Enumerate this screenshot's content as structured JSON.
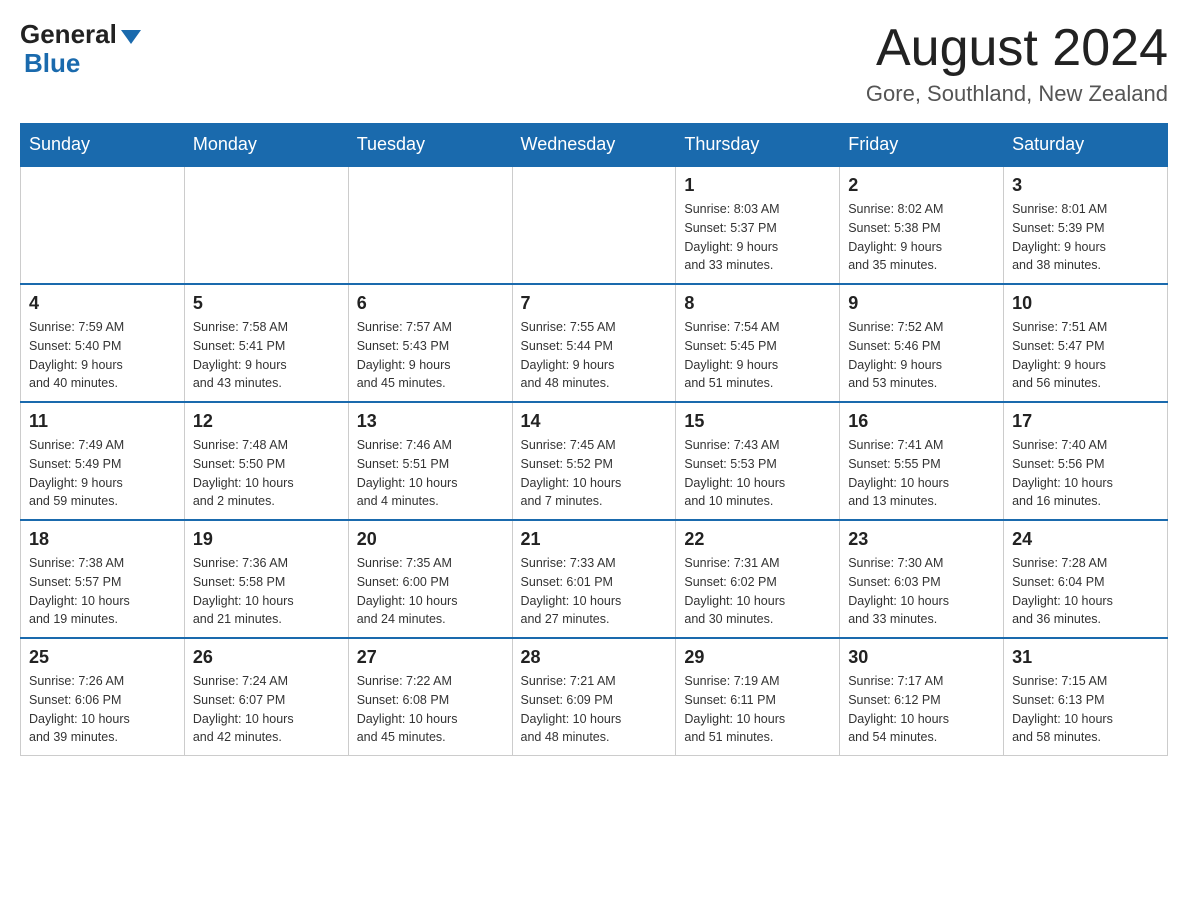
{
  "header": {
    "logo_general": "General",
    "logo_blue": "Blue",
    "month_title": "August 2024",
    "location": "Gore, Southland, New Zealand"
  },
  "days_of_week": [
    "Sunday",
    "Monday",
    "Tuesday",
    "Wednesday",
    "Thursday",
    "Friday",
    "Saturday"
  ],
  "weeks": [
    [
      {
        "day": "",
        "info": ""
      },
      {
        "day": "",
        "info": ""
      },
      {
        "day": "",
        "info": ""
      },
      {
        "day": "",
        "info": ""
      },
      {
        "day": "1",
        "info": "Sunrise: 8:03 AM\nSunset: 5:37 PM\nDaylight: 9 hours\nand 33 minutes."
      },
      {
        "day": "2",
        "info": "Sunrise: 8:02 AM\nSunset: 5:38 PM\nDaylight: 9 hours\nand 35 minutes."
      },
      {
        "day": "3",
        "info": "Sunrise: 8:01 AM\nSunset: 5:39 PM\nDaylight: 9 hours\nand 38 minutes."
      }
    ],
    [
      {
        "day": "4",
        "info": "Sunrise: 7:59 AM\nSunset: 5:40 PM\nDaylight: 9 hours\nand 40 minutes."
      },
      {
        "day": "5",
        "info": "Sunrise: 7:58 AM\nSunset: 5:41 PM\nDaylight: 9 hours\nand 43 minutes."
      },
      {
        "day": "6",
        "info": "Sunrise: 7:57 AM\nSunset: 5:43 PM\nDaylight: 9 hours\nand 45 minutes."
      },
      {
        "day": "7",
        "info": "Sunrise: 7:55 AM\nSunset: 5:44 PM\nDaylight: 9 hours\nand 48 minutes."
      },
      {
        "day": "8",
        "info": "Sunrise: 7:54 AM\nSunset: 5:45 PM\nDaylight: 9 hours\nand 51 minutes."
      },
      {
        "day": "9",
        "info": "Sunrise: 7:52 AM\nSunset: 5:46 PM\nDaylight: 9 hours\nand 53 minutes."
      },
      {
        "day": "10",
        "info": "Sunrise: 7:51 AM\nSunset: 5:47 PM\nDaylight: 9 hours\nand 56 minutes."
      }
    ],
    [
      {
        "day": "11",
        "info": "Sunrise: 7:49 AM\nSunset: 5:49 PM\nDaylight: 9 hours\nand 59 minutes."
      },
      {
        "day": "12",
        "info": "Sunrise: 7:48 AM\nSunset: 5:50 PM\nDaylight: 10 hours\nand 2 minutes."
      },
      {
        "day": "13",
        "info": "Sunrise: 7:46 AM\nSunset: 5:51 PM\nDaylight: 10 hours\nand 4 minutes."
      },
      {
        "day": "14",
        "info": "Sunrise: 7:45 AM\nSunset: 5:52 PM\nDaylight: 10 hours\nand 7 minutes."
      },
      {
        "day": "15",
        "info": "Sunrise: 7:43 AM\nSunset: 5:53 PM\nDaylight: 10 hours\nand 10 minutes."
      },
      {
        "day": "16",
        "info": "Sunrise: 7:41 AM\nSunset: 5:55 PM\nDaylight: 10 hours\nand 13 minutes."
      },
      {
        "day": "17",
        "info": "Sunrise: 7:40 AM\nSunset: 5:56 PM\nDaylight: 10 hours\nand 16 minutes."
      }
    ],
    [
      {
        "day": "18",
        "info": "Sunrise: 7:38 AM\nSunset: 5:57 PM\nDaylight: 10 hours\nand 19 minutes."
      },
      {
        "day": "19",
        "info": "Sunrise: 7:36 AM\nSunset: 5:58 PM\nDaylight: 10 hours\nand 21 minutes."
      },
      {
        "day": "20",
        "info": "Sunrise: 7:35 AM\nSunset: 6:00 PM\nDaylight: 10 hours\nand 24 minutes."
      },
      {
        "day": "21",
        "info": "Sunrise: 7:33 AM\nSunset: 6:01 PM\nDaylight: 10 hours\nand 27 minutes."
      },
      {
        "day": "22",
        "info": "Sunrise: 7:31 AM\nSunset: 6:02 PM\nDaylight: 10 hours\nand 30 minutes."
      },
      {
        "day": "23",
        "info": "Sunrise: 7:30 AM\nSunset: 6:03 PM\nDaylight: 10 hours\nand 33 minutes."
      },
      {
        "day": "24",
        "info": "Sunrise: 7:28 AM\nSunset: 6:04 PM\nDaylight: 10 hours\nand 36 minutes."
      }
    ],
    [
      {
        "day": "25",
        "info": "Sunrise: 7:26 AM\nSunset: 6:06 PM\nDaylight: 10 hours\nand 39 minutes."
      },
      {
        "day": "26",
        "info": "Sunrise: 7:24 AM\nSunset: 6:07 PM\nDaylight: 10 hours\nand 42 minutes."
      },
      {
        "day": "27",
        "info": "Sunrise: 7:22 AM\nSunset: 6:08 PM\nDaylight: 10 hours\nand 45 minutes."
      },
      {
        "day": "28",
        "info": "Sunrise: 7:21 AM\nSunset: 6:09 PM\nDaylight: 10 hours\nand 48 minutes."
      },
      {
        "day": "29",
        "info": "Sunrise: 7:19 AM\nSunset: 6:11 PM\nDaylight: 10 hours\nand 51 minutes."
      },
      {
        "day": "30",
        "info": "Sunrise: 7:17 AM\nSunset: 6:12 PM\nDaylight: 10 hours\nand 54 minutes."
      },
      {
        "day": "31",
        "info": "Sunrise: 7:15 AM\nSunset: 6:13 PM\nDaylight: 10 hours\nand 58 minutes."
      }
    ]
  ]
}
